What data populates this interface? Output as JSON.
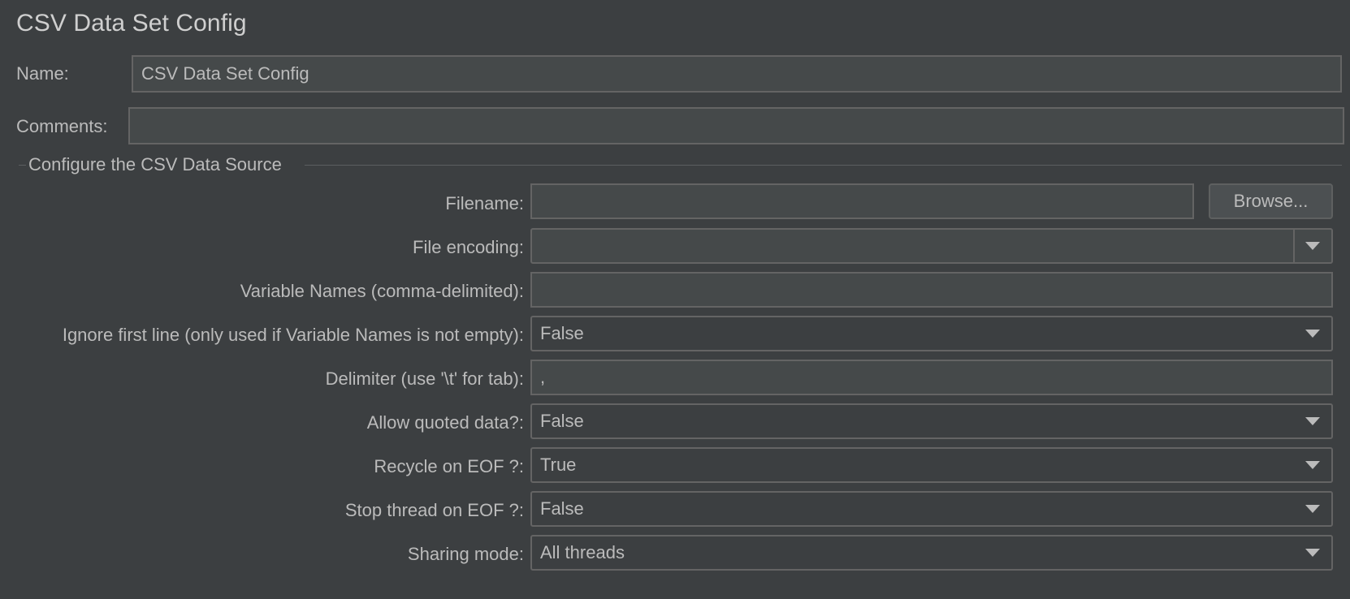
{
  "header": {
    "title": "CSV Data Set Config"
  },
  "name": {
    "label": "Name:",
    "value": "CSV Data Set Config"
  },
  "comments": {
    "label": "Comments:",
    "value": ""
  },
  "group": {
    "title": "Configure the CSV Data Source"
  },
  "filename": {
    "label": "Filename:",
    "value": "",
    "browse_label": "Browse..."
  },
  "file_encoding": {
    "label": "File encoding:",
    "value": ""
  },
  "variable_names": {
    "label": "Variable Names (comma-delimited):",
    "value": ""
  },
  "ignore_first_line": {
    "label": "Ignore first line (only used if Variable Names is not empty):",
    "value": "False"
  },
  "delimiter": {
    "label": "Delimiter (use '\\t' for tab):",
    "value": ","
  },
  "allow_quoted": {
    "label": "Allow quoted data?:",
    "value": "False"
  },
  "recycle_eof": {
    "label": "Recycle on EOF ?:",
    "value": "True"
  },
  "stop_thread_eof": {
    "label": "Stop thread on EOF ?:",
    "value": "False"
  },
  "sharing_mode": {
    "label": "Sharing mode:",
    "value": "All threads"
  },
  "icons": {
    "dropdown": "chevron-down-icon"
  },
  "colors": {
    "background": "#3c3f41",
    "field_background": "#45494a",
    "border": "#646464",
    "text": "#bbbbbb"
  }
}
